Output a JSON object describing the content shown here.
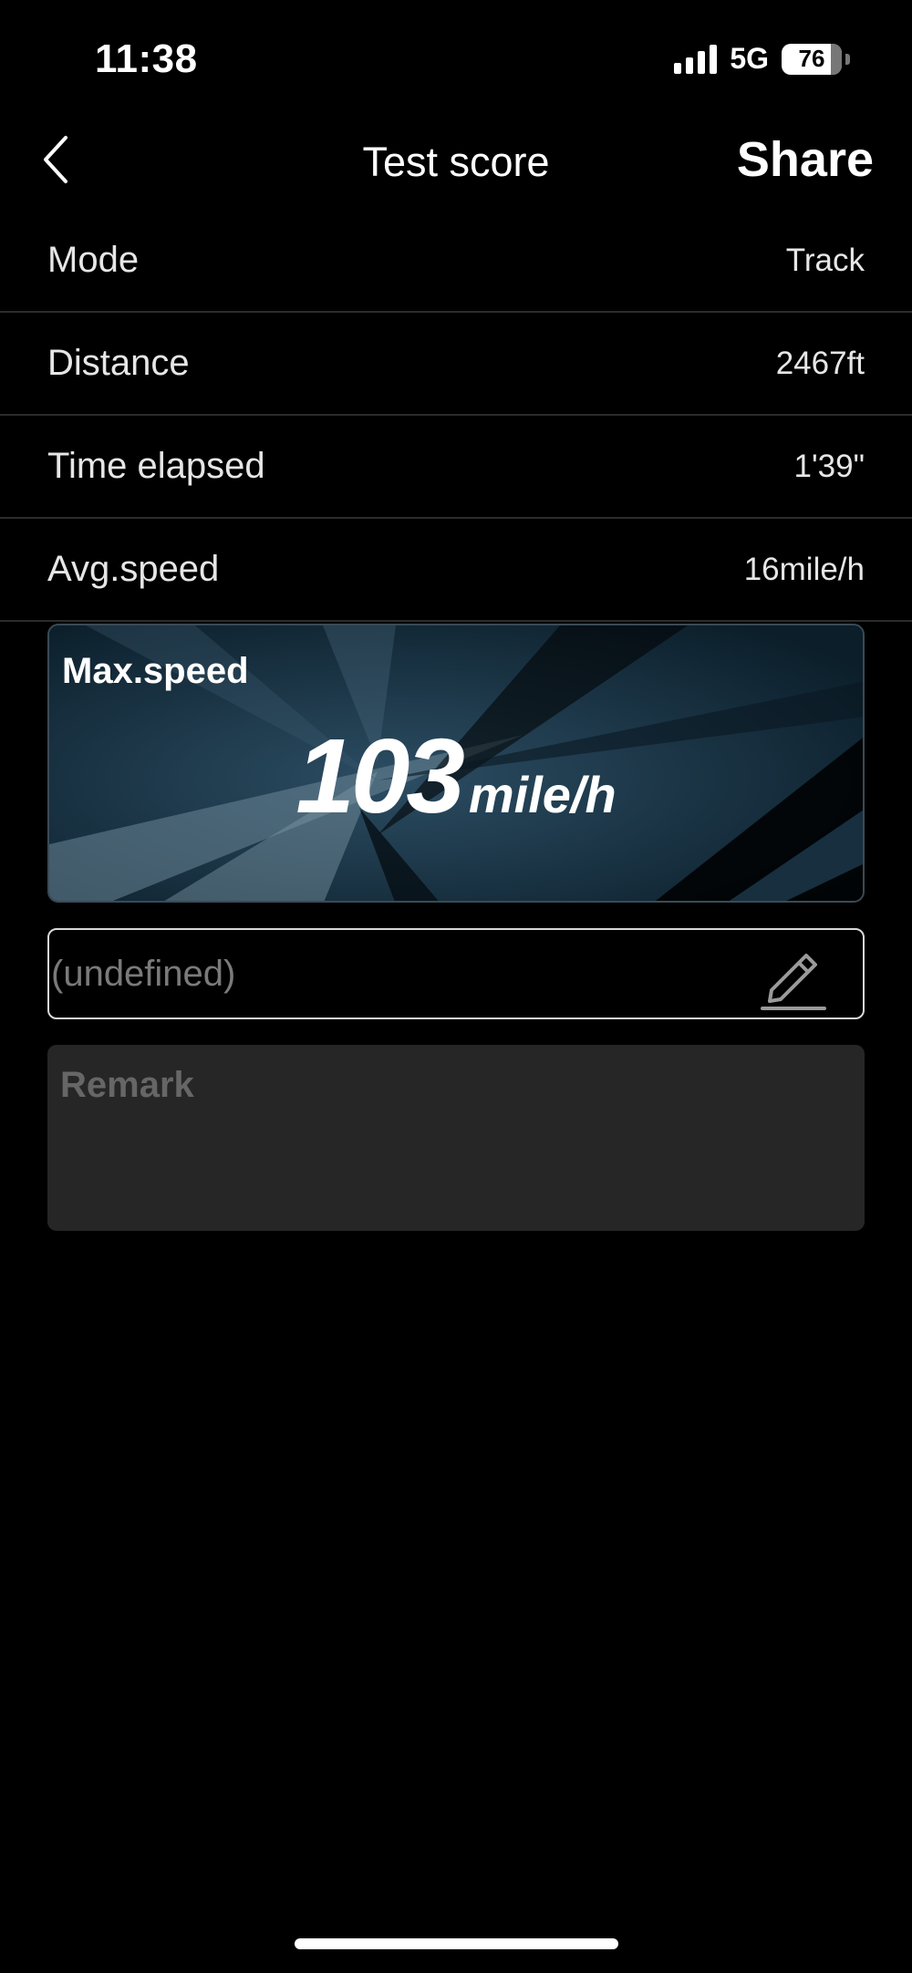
{
  "status_bar": {
    "time": "11:38",
    "network": "5G",
    "battery_level": "76"
  },
  "nav": {
    "title": "Test score",
    "share_label": "Share",
    "back_icon": "chevron-left-icon"
  },
  "info_rows": [
    {
      "label": "Mode",
      "value": "Track"
    },
    {
      "label": "Distance",
      "value": "2467ft"
    },
    {
      "label": "Time elapsed",
      "value": "1'39\""
    },
    {
      "label": "Avg.speed",
      "value": "16mile/h"
    }
  ],
  "max_speed": {
    "label": "Max.speed",
    "value": "103",
    "unit": "mile/h"
  },
  "name_field": {
    "value": "(undefined)",
    "edit_icon": "pencil-icon"
  },
  "remark": {
    "placeholder": "Remark"
  },
  "colors": {
    "background": "#000000",
    "card_background": "#0e2634",
    "remark_background": "#262626",
    "placeholder_text": "#7a7a7a"
  }
}
